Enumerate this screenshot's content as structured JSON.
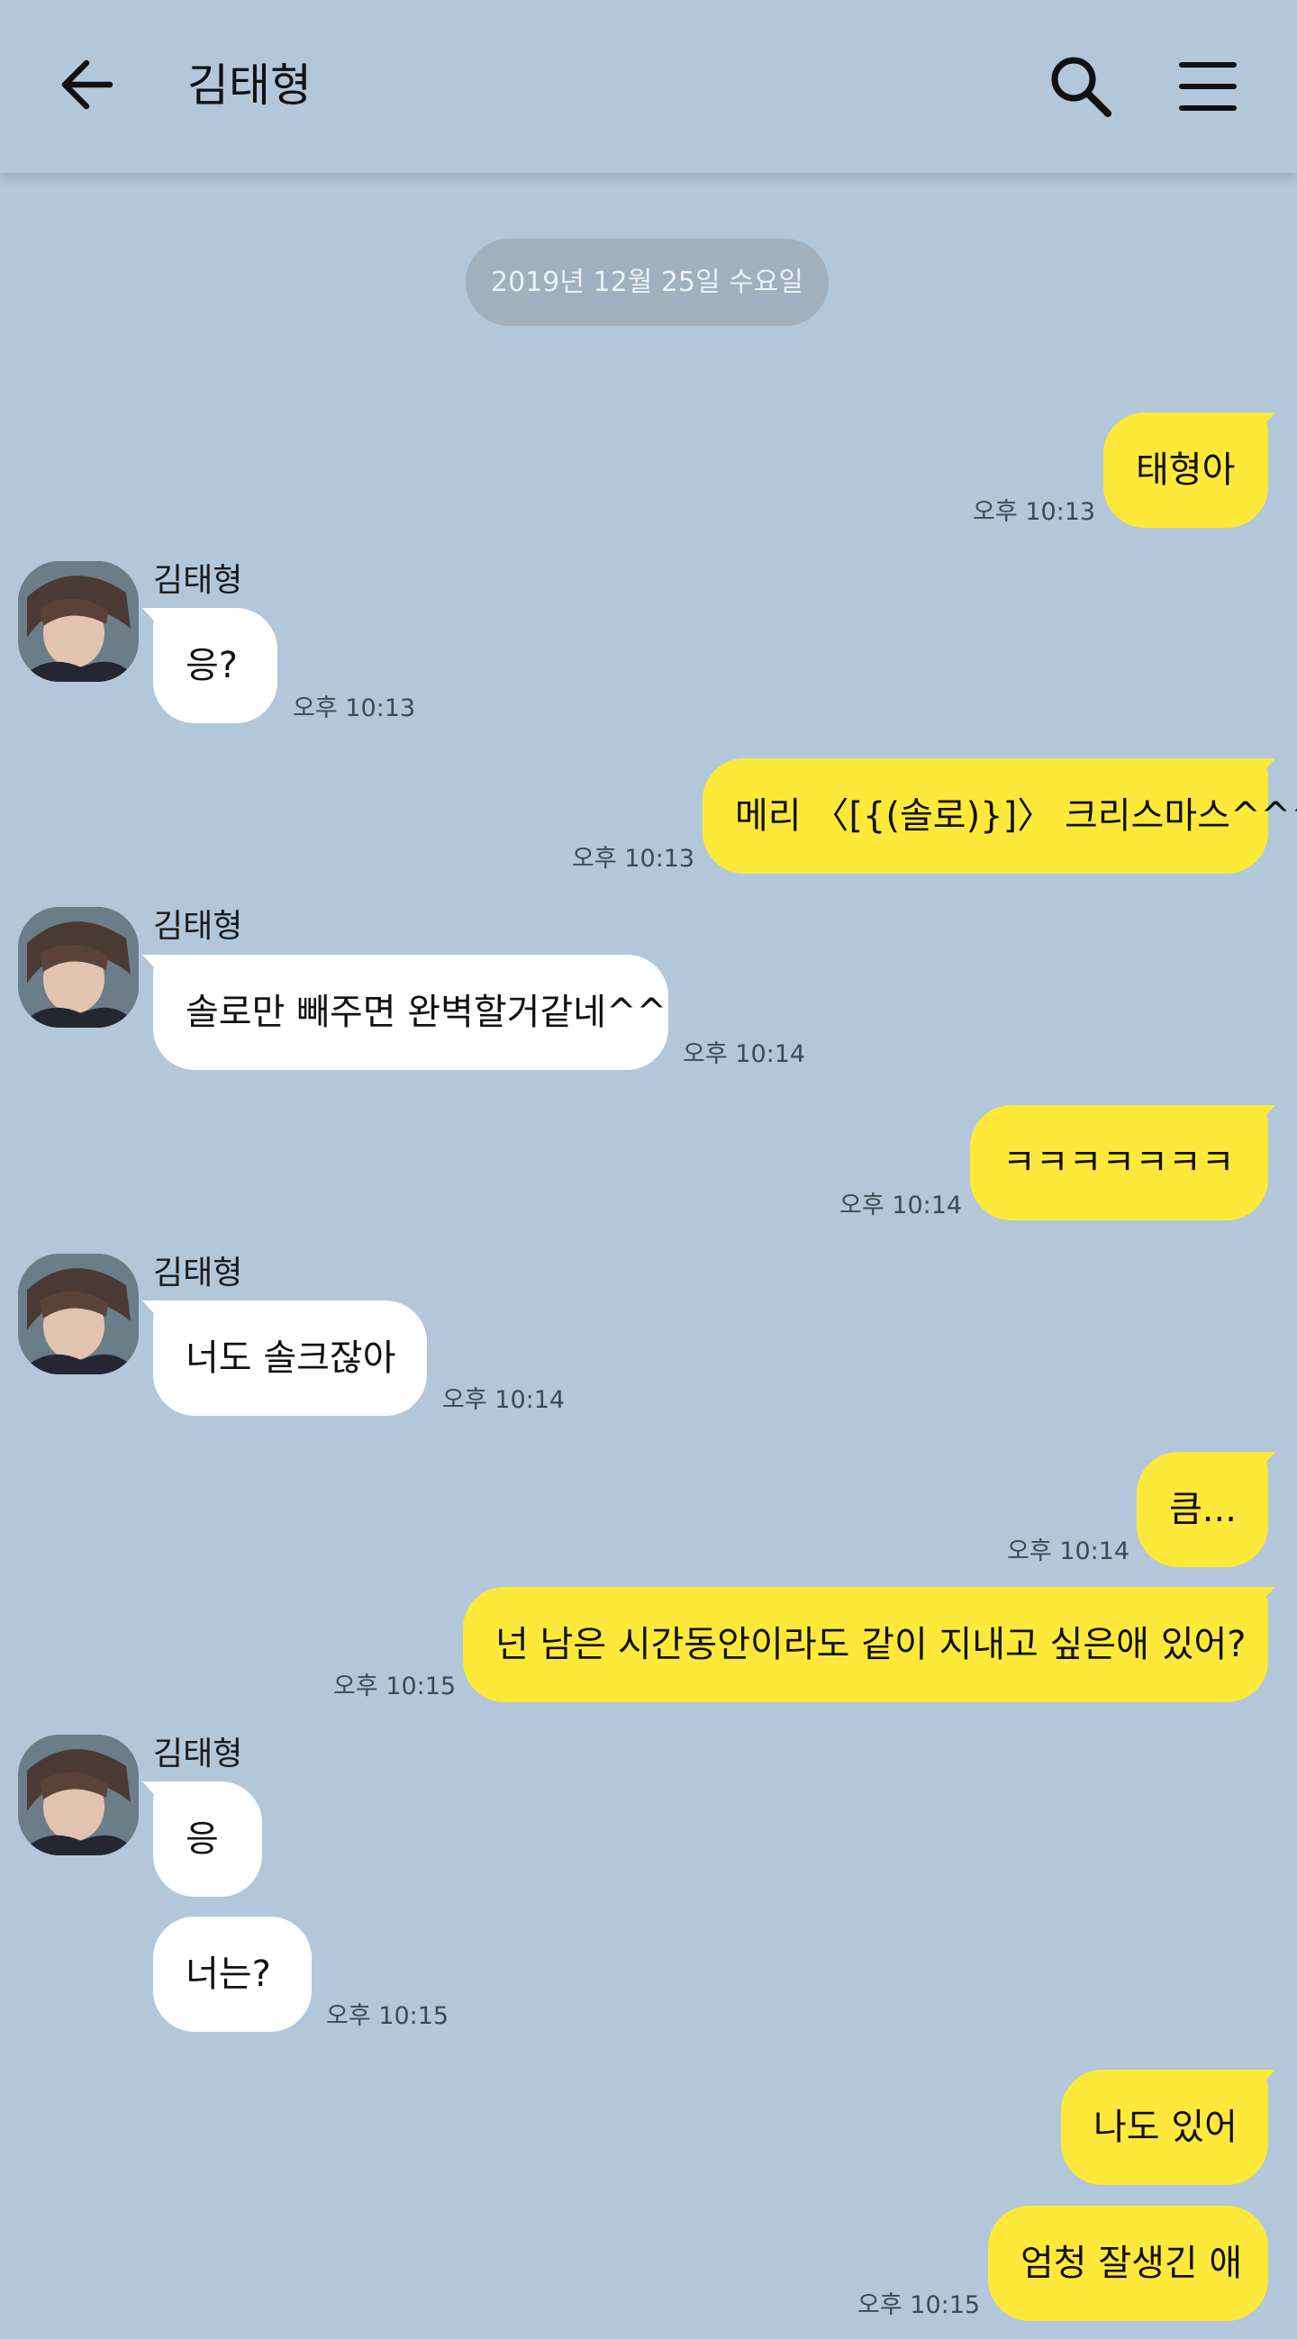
{
  "header": {
    "title": "김태형",
    "back_icon": "arrow-left-icon",
    "search_icon": "search-icon",
    "menu_icon": "hamburger-menu-icon"
  },
  "date_divider": "2019년 12월 25일 수요일",
  "colors": {
    "background": "#b2c7da",
    "my_bubble": "#fee93a",
    "other_bubble": "#ffffff",
    "date_pill": "#a0b0be"
  },
  "messages": [
    {
      "from": "me",
      "text": "태형아",
      "time": "오후 10:13"
    },
    {
      "from": "other",
      "sender": "김태형",
      "text": "응?",
      "time": "오후 10:13"
    },
    {
      "from": "me",
      "text": "메리 〈[{(솔로)}]〉 크리스마스^^^",
      "time": "오후 10:13"
    },
    {
      "from": "other",
      "sender": "김태형",
      "text": "솔로만 빼주면 완벽할거같네^^",
      "time": "오후 10:14"
    },
    {
      "from": "me",
      "text": "ㅋㅋㅋㅋㅋㅋㅋ",
      "time": "오후 10:14"
    },
    {
      "from": "other",
      "sender": "김태형",
      "text": "너도 솔크잖아",
      "time": "오후 10:14"
    },
    {
      "from": "me",
      "text": "큼...",
      "time": "오후 10:14"
    },
    {
      "from": "me",
      "text": "넌 남은 시간동안이라도 같이 지내고 싶은애 있어?",
      "time": "오후 10:15"
    },
    {
      "from": "other",
      "sender": "김태형",
      "text": "응",
      "time": ""
    },
    {
      "from": "other",
      "text": "너는?",
      "time": "오후 10:15"
    },
    {
      "from": "me",
      "text": "나도 있어",
      "time": ""
    },
    {
      "from": "me",
      "text": "엄청 잘생긴 애",
      "time": "오후 10:15"
    }
  ]
}
